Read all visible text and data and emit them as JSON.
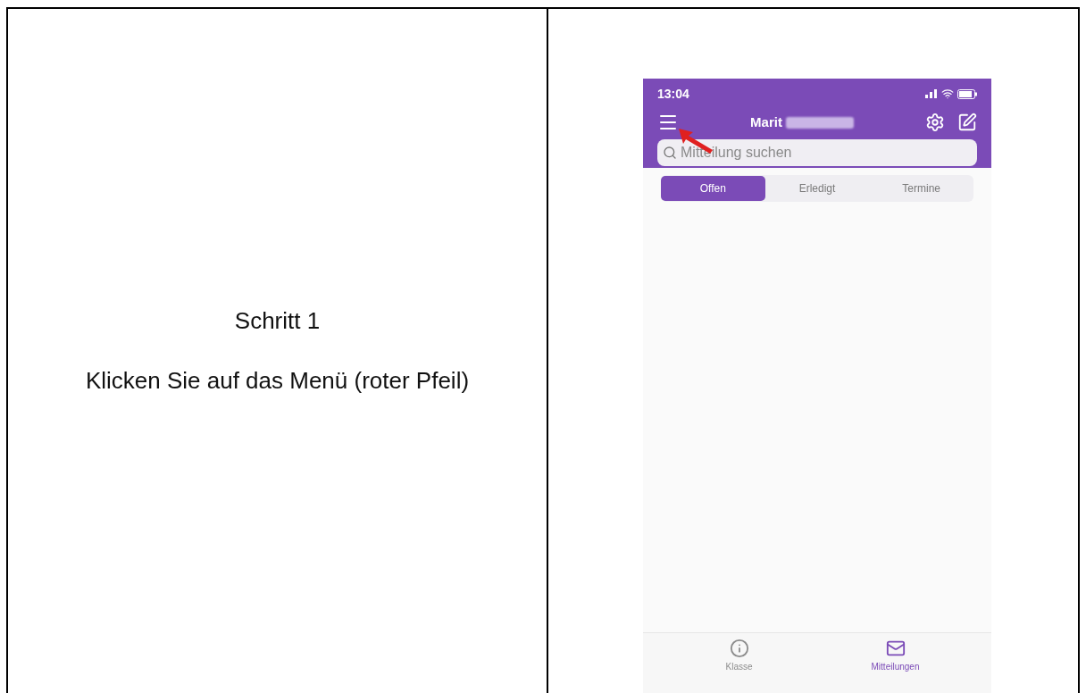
{
  "left_cell": {
    "step": "Schritt 1",
    "instruction": "Klicken Sie auf das Menü (roter Pfeil)"
  },
  "phone": {
    "status_bar": {
      "time": "13:04"
    },
    "header": {
      "title": "Marit",
      "name_redacted": true
    },
    "search": {
      "placeholder": "Mitteilung suchen"
    },
    "segments": [
      {
        "label": "Offen",
        "selected": true
      },
      {
        "label": "Erledigt",
        "selected": false
      },
      {
        "label": "Termine",
        "selected": false
      }
    ],
    "tab_bar": [
      {
        "label": "Klasse",
        "selected": false,
        "kind": "info"
      },
      {
        "label": "Mitteilungen",
        "selected": true,
        "kind": "mail"
      }
    ]
  }
}
